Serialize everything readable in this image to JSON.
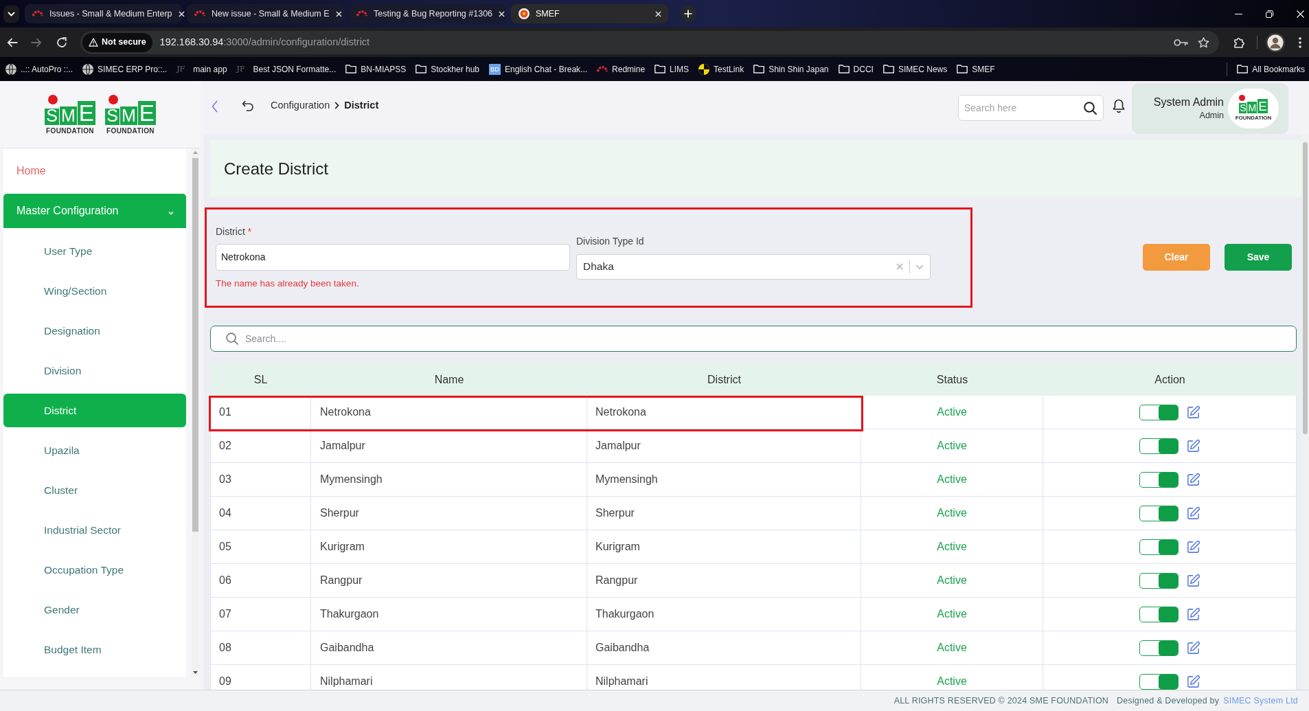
{
  "browser": {
    "tabs": [
      {
        "kind": "redmine",
        "title": "Issues - Small & Medium Enterp",
        "selected": false
      },
      {
        "kind": "redmine",
        "title": "New issue - Small & Medium E",
        "selected": false
      },
      {
        "kind": "redmine",
        "title": "Testing & Bug Reporting #1306",
        "selected": false
      },
      {
        "kind": "site",
        "title": "SMEF",
        "selected": true
      }
    ],
    "security": "Not secure",
    "url_host": "192.168.30.94",
    "url_path": ":3000/admin/configuration/district",
    "bookmarks": [
      {
        "kind": "globe",
        "label": "..:: AutoPro ::.."
      },
      {
        "kind": "globe",
        "label": "SIMEC ERP Pro::.."
      },
      {
        "kind": "jf",
        "icon_text": "JF",
        "label": "main app"
      },
      {
        "kind": "jf",
        "icon_text": "JF",
        "label": "Best JSON Formatte..."
      },
      {
        "kind": "folder",
        "label": "BN-MIAPSS"
      },
      {
        "kind": "folder",
        "label": "Stockher hub"
      },
      {
        "kind": "bd",
        "icon_text": "BD",
        "label": "English Chat - Break..."
      },
      {
        "kind": "redmine",
        "label": "Redmine"
      },
      {
        "kind": "folder",
        "label": "LIMS"
      },
      {
        "kind": "testlink",
        "label": "TestLink"
      },
      {
        "kind": "folder",
        "label": "Shin Shin Japan"
      },
      {
        "kind": "folder",
        "label": "DCCI"
      },
      {
        "kind": "folder",
        "label": "SIMEC News"
      },
      {
        "kind": "folder",
        "label": "SMEF"
      }
    ],
    "all_bookmarks": "All Bookmarks"
  },
  "sidebar": {
    "logos": [
      {
        "mark": "SME",
        "caption": "FOUNDATION"
      },
      {
        "mark": "SME",
        "caption": "FOUNDATION"
      }
    ],
    "home": "Home",
    "menu": [
      {
        "label": "Master Configuration",
        "expanded": true,
        "children": [
          {
            "label": "User Type",
            "selected": false
          },
          {
            "label": "Wing/Section",
            "selected": false
          },
          {
            "label": "Designation",
            "selected": false
          },
          {
            "label": "Division",
            "selected": false
          },
          {
            "label": "District",
            "selected": true
          },
          {
            "label": "Upazila",
            "selected": false
          },
          {
            "label": "Cluster",
            "selected": false
          },
          {
            "label": "Industrial Sector",
            "selected": false
          },
          {
            "label": "Occupation Type",
            "selected": false
          },
          {
            "label": "Gender",
            "selected": false
          },
          {
            "label": "Budget Item",
            "selected": false
          }
        ]
      }
    ]
  },
  "header": {
    "breadcrumb": [
      "Configuration",
      "District"
    ],
    "search": {
      "placeholder": "Search here"
    },
    "user": {
      "name": "System Admin",
      "role": "Admin",
      "logo": {
        "mark": "SME",
        "caption": "FOUNDATION"
      }
    }
  },
  "form": {
    "title": "Create District",
    "highlighted": true,
    "fields": [
      {
        "kind": "text",
        "label": "District",
        "required_mark": "*",
        "value": "Netrokona",
        "error": "The name has already been taken."
      },
      {
        "kind": "select",
        "label": "Division Type Id",
        "value": "Dhaka"
      }
    ],
    "buttons": [
      {
        "kind": "secondary",
        "label": "Clear"
      },
      {
        "kind": "primary",
        "label": "Save"
      }
    ]
  },
  "table": {
    "search": {
      "placeholder": "Search...."
    },
    "columns": [
      "SL",
      "Name",
      "District",
      "Status",
      "Action"
    ],
    "rows": [
      {
        "sl": "01",
        "name": "Netrokona",
        "district": "Netrokona",
        "status": "Active",
        "enabled": true,
        "highlighted": true
      },
      {
        "sl": "02",
        "name": "Jamalpur",
        "district": "Jamalpur",
        "status": "Active",
        "enabled": true,
        "highlighted": false
      },
      {
        "sl": "03",
        "name": "Mymensingh",
        "district": "Mymensingh",
        "status": "Active",
        "enabled": true,
        "highlighted": false
      },
      {
        "sl": "04",
        "name": "Sherpur",
        "district": "Sherpur",
        "status": "Active",
        "enabled": true,
        "highlighted": false
      },
      {
        "sl": "05",
        "name": "Kurigram",
        "district": "Kurigram",
        "status": "Active",
        "enabled": true,
        "highlighted": false
      },
      {
        "sl": "06",
        "name": "Rangpur",
        "district": "Rangpur",
        "status": "Active",
        "enabled": true,
        "highlighted": false
      },
      {
        "sl": "07",
        "name": "Thakurgaon",
        "district": "Thakurgaon",
        "status": "Active",
        "enabled": true,
        "highlighted": false
      },
      {
        "sl": "08",
        "name": "Gaibandha",
        "district": "Gaibandha",
        "status": "Active",
        "enabled": true,
        "highlighted": false
      },
      {
        "sl": "09",
        "name": "Nilphamari",
        "district": "Nilphamari",
        "status": "Active",
        "enabled": true,
        "highlighted": false
      }
    ]
  },
  "footer": {
    "rights": "ALL RIGHTS RESERVED © 2024 SME FOUNDATION",
    "credit": "Designed & Developed by",
    "company": "SIMEC System Ltd"
  }
}
